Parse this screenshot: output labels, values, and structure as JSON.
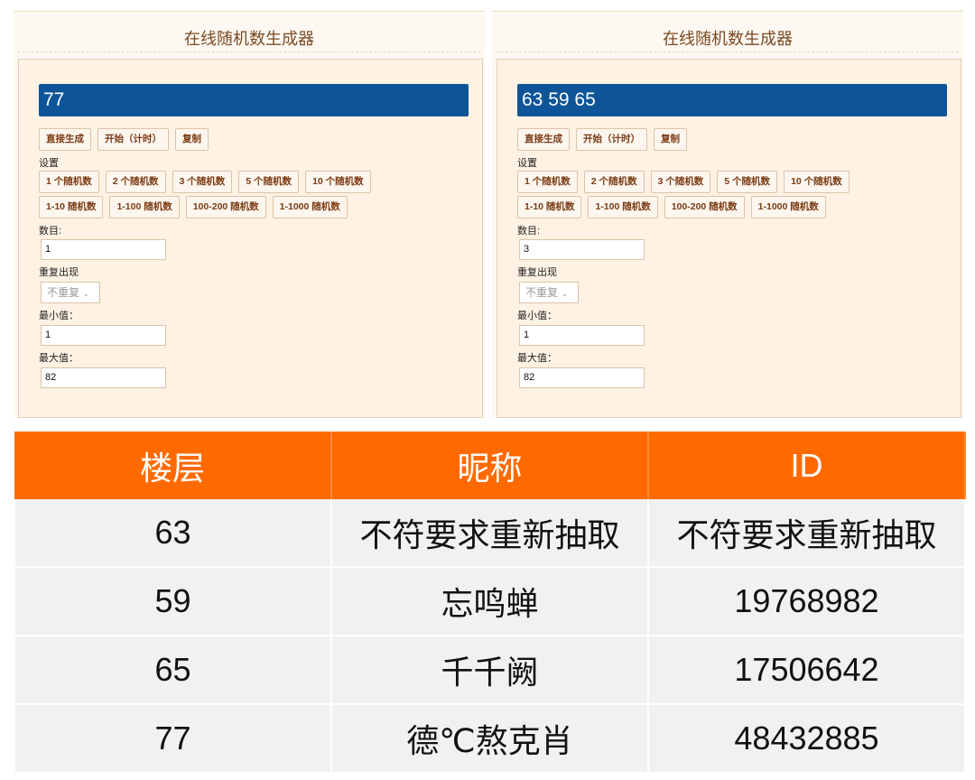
{
  "panels": [
    {
      "title": "在线随机数生成器",
      "result": "77",
      "actions": [
        "直接生成",
        "开始（计时）",
        "复制"
      ],
      "settings_label": "设置",
      "presets_row1": [
        "1 个随机数",
        "2 个随机数",
        "3 个随机数",
        "5 个随机数",
        "10 个随机数"
      ],
      "presets_row2": [
        "1-10 随机数",
        "1-100 随机数",
        "100-200 随机数",
        "1-1000 随机数"
      ],
      "count_label": "数目:",
      "count": "1",
      "repeat_label": "重复出现",
      "repeat": "不重复",
      "min_label": "最小值：",
      "min": "1",
      "max_label": "最大值：",
      "max": "82"
    },
    {
      "title": "在线随机数生成器",
      "result": "63 59 65",
      "actions": [
        "直接生成",
        "开始（计时）",
        "复制"
      ],
      "settings_label": "设置",
      "presets_row1": [
        "1 个随机数",
        "2 个随机数",
        "3 个随机数",
        "5 个随机数",
        "10 个随机数"
      ],
      "presets_row2": [
        "1-10 随机数",
        "1-100 随机数",
        "100-200 随机数",
        "1-1000 随机数"
      ],
      "count_label": "数目:",
      "count": "3",
      "repeat_label": "重复出现",
      "repeat": "不重复",
      "min_label": "最小值：",
      "min": "1",
      "max_label": "最大值：",
      "max": "82"
    }
  ],
  "table": {
    "headers": [
      "楼层",
      "昵称",
      "ID"
    ],
    "rows": [
      [
        "63",
        "不符要求重新抽取",
        "不符要求重新抽取"
      ],
      [
        "59",
        "忘鸣蝉",
        "19768982"
      ],
      [
        "65",
        "千千阙",
        "17506642"
      ],
      [
        "77",
        "德℃熬克肖",
        "48432885"
      ]
    ]
  },
  "colors": {
    "result_bar": "#0d5598",
    "table_header": "#ff6a00",
    "button_text": "#7a3b14"
  }
}
